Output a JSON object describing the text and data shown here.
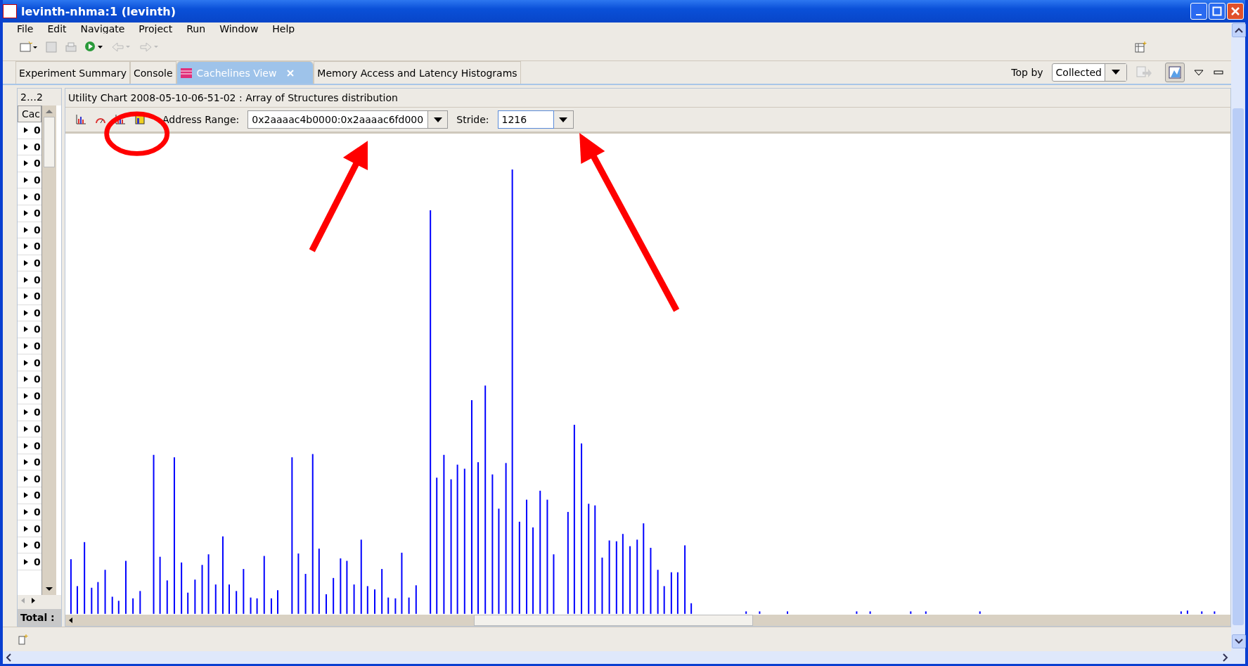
{
  "window": {
    "title": "levinth-nhma:1 (levinth)"
  },
  "menu": [
    "File",
    "Edit",
    "Navigate",
    "Project",
    "Run",
    "Window",
    "Help"
  ],
  "tabs": [
    {
      "label": "Experiment Summary",
      "selected": false
    },
    {
      "label": "Console",
      "selected": false
    },
    {
      "label": "Cachelines View",
      "selected": true
    },
    {
      "label": "Memory Access and Latency Histograms",
      "selected": false
    }
  ],
  "top_by": {
    "label": "Top by",
    "value": "Collected"
  },
  "left_panel": {
    "tab": "2…2",
    "header": "Cac",
    "rows": [
      {
        "text": "0",
        "expanded": false
      },
      {
        "text": "0",
        "expanded": false
      },
      {
        "text": "0",
        "expanded": false
      },
      {
        "text": "0",
        "expanded": false
      },
      {
        "text": "0",
        "expanded": false
      },
      {
        "text": "0",
        "expanded": false
      },
      {
        "text": "0",
        "expanded": false
      },
      {
        "text": "0",
        "expanded": false
      },
      {
        "text": "0",
        "expanded": false
      },
      {
        "text": "0",
        "expanded": false
      },
      {
        "text": "0",
        "expanded": false
      },
      {
        "text": "0",
        "expanded": false
      },
      {
        "text": "0",
        "expanded": false
      },
      {
        "text": "0",
        "expanded": false
      },
      {
        "text": "0",
        "expanded": false
      },
      {
        "text": "0",
        "expanded": false
      },
      {
        "text": "0",
        "expanded": false
      },
      {
        "text": "0",
        "expanded": false
      },
      {
        "text": "0",
        "expanded": false
      },
      {
        "text": "0",
        "expanded": false
      },
      {
        "text": "0",
        "expanded": false
      },
      {
        "text": "0",
        "expanded": false
      },
      {
        "text": "0",
        "expanded": false
      },
      {
        "text": "0",
        "expanded": false
      },
      {
        "text": "0",
        "expanded": false
      },
      {
        "text": "0",
        "expanded": false
      },
      {
        "text": "0",
        "expanded": false
      }
    ],
    "footer": "Total :"
  },
  "chart_view": {
    "title": "Utility Chart 2008-05-10-06-51-02 : Array of Structures distribution",
    "address_label": "Address Range:",
    "address_value": "0x2aaaac4b0000:0x2aaaac6fd000",
    "stride_label": "Stride:",
    "stride_value": "1216"
  }
}
